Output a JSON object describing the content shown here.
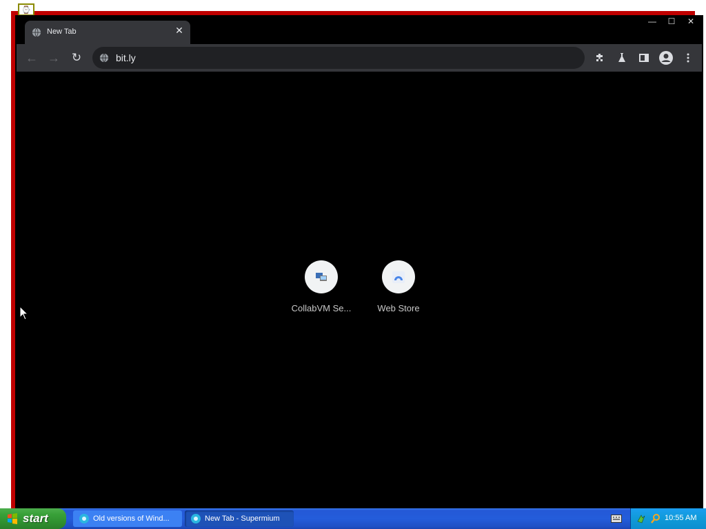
{
  "browser": {
    "tab_title": "New Tab",
    "tab_close": "✕",
    "window_controls": [
      "—",
      "☐",
      "✕"
    ],
    "url": "bit.ly",
    "shortcuts": [
      {
        "label": "CollabVM Se...",
        "icon": "collabvm-icon"
      },
      {
        "label": "Web Store",
        "icon": "web-store-icon"
      }
    ],
    "toolbar_icons": [
      "extensions-icon",
      "labs-icon",
      "side-panel-icon",
      "profile-icon",
      "menu-icon"
    ]
  },
  "taskbar": {
    "start_label": "start",
    "tasks": [
      {
        "label": "Old versions of Wind...",
        "active": false
      },
      {
        "label": "New Tab - Supermium",
        "active": true
      }
    ],
    "clock": "10:55 AM"
  },
  "colors": {
    "frame": "#c00000",
    "browser_bg": "#000000",
    "toolbar": "#35363a",
    "omnibox": "#202124",
    "taskbar": "#245ddb",
    "start": "#38a038",
    "tray": "#109ad8"
  }
}
